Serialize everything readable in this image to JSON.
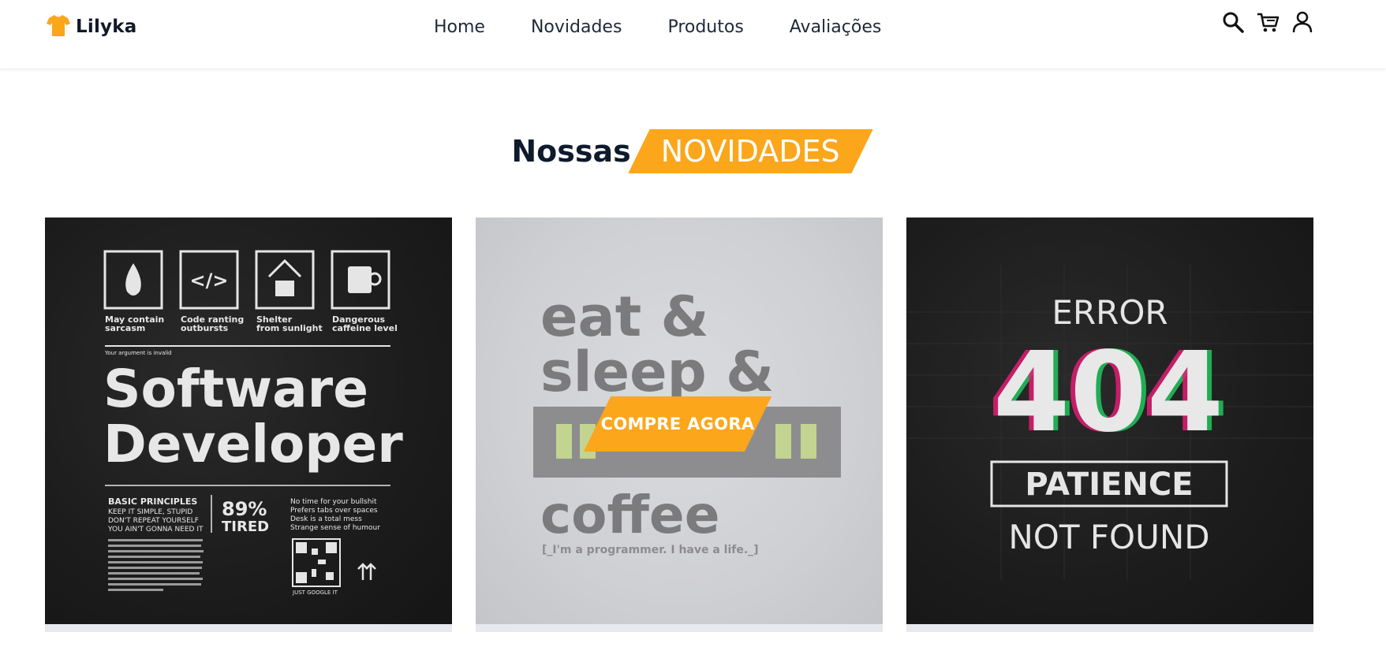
{
  "brand": {
    "name": "Lilyka",
    "accent": "#fba61b"
  },
  "nav": {
    "items": [
      "Home",
      "Novidades",
      "Produtos",
      "Avaliações"
    ]
  },
  "header_icons": [
    "search-icon",
    "cart-icon",
    "user-icon"
  ],
  "section": {
    "title_plain": "Nossas",
    "title_highlight": "NOVIDADES"
  },
  "products": [
    {
      "shirt_color": "black",
      "print": {
        "badges": [
          "May contain sarcasm",
          "Code ranting outbursts",
          "Shelter from sunlight",
          "Dangerous caffeine level"
        ],
        "small_line": "Your argument is invalid",
        "headline_1": "Software",
        "headline_2": "Developer",
        "principles_title": "BASIC PRINCIPLES",
        "principles": [
          "KEEP IT SIMPLE, STUPID",
          "DON'T REPEAT YOURSELF",
          "YOU AIN'T GONNA NEED IT"
        ],
        "stat_value": "89%",
        "stat_label": "TIRED",
        "notes": [
          "No time for your bullshit",
          "Prefers tabs over spaces",
          "Desk is a total mess",
          "Strange sense of humour"
        ],
        "qr_caption": "JUST GOOGLE IT"
      }
    },
    {
      "shirt_color": "light-grey",
      "print": {
        "line_1": "eat &",
        "line_2": "sleep &",
        "line_4": "coffee",
        "subline": "[_I'm a programmer. I have a life._]"
      },
      "cta_label": "COMPRE AGORA"
    },
    {
      "shirt_color": "black",
      "print": {
        "line_1": "ERROR",
        "code": "404",
        "line_3": "PATIENCE",
        "line_4": "NOT FOUND"
      }
    }
  ]
}
